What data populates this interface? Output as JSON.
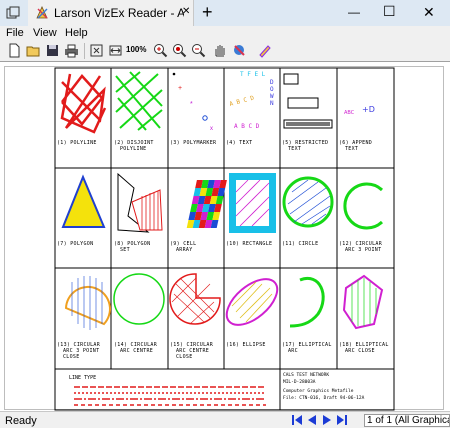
{
  "window": {
    "tab_title": "Larson VizEx Reader - A",
    "new_tab": "+",
    "minimize": "—",
    "maximize": "☐",
    "close": "✕"
  },
  "menu": {
    "items": [
      "File",
      "View",
      "Help"
    ]
  },
  "toolbar": {
    "zoom_label": "100%",
    "icons": [
      "new-file-icon",
      "open-folder-icon",
      "save-icon",
      "print-icon",
      "fit-page-icon",
      "fit-width-icon",
      "zoom-100-icon",
      "zoom-in-icon",
      "zoom-window-icon",
      "zoom-out-icon",
      "pan-hand-icon",
      "layers-icon",
      "markup-icon"
    ]
  },
  "drawing": {
    "cells": [
      {
        "n": 1,
        "caption": [
          "(1) POLYLINE"
        ]
      },
      {
        "n": 2,
        "caption": [
          "(2) DISJOINT",
          "POLYLINE"
        ]
      },
      {
        "n": 3,
        "caption": [
          "(3) POLYMARKER"
        ]
      },
      {
        "n": 4,
        "caption": [
          "(4) TEXT"
        ]
      },
      {
        "n": 5,
        "caption": [
          "(5) RESTRICTED",
          "TEXT"
        ]
      },
      {
        "n": 6,
        "caption": [
          "(6) APPEND",
          "TEXT"
        ]
      },
      {
        "n": 7,
        "caption": [
          "(7) POLYGON"
        ]
      },
      {
        "n": 8,
        "caption": [
          "(8) POLYGON",
          "SET"
        ]
      },
      {
        "n": 9,
        "caption": [
          "(9) CELL",
          "ARRAY"
        ]
      },
      {
        "n": 10,
        "caption": [
          "(10) RECTANGLE"
        ]
      },
      {
        "n": 11,
        "caption": [
          "(11) CIRCLE"
        ]
      },
      {
        "n": 12,
        "caption": [
          "(12) CIRCULAR",
          "ARC 3 POINT"
        ]
      },
      {
        "n": 13,
        "caption": [
          "(13) CIRCULAR",
          "ARC 3 POINT",
          "CLOSE"
        ]
      },
      {
        "n": 14,
        "caption": [
          "(14) CIRCULAR",
          "ARC CENTRE"
        ]
      },
      {
        "n": 15,
        "caption": [
          "(15) CIRCULAR",
          "ARC CENTRE",
          "CLOSE"
        ]
      },
      {
        "n": 16,
        "caption": [
          "(16) ELLIPSE"
        ]
      },
      {
        "n": 17,
        "caption": [
          "(17) ELLIPTICAL",
          "ARC"
        ]
      },
      {
        "n": 18,
        "caption": [
          "(18) ELLIPTICAL",
          "ARC CLOSE"
        ]
      }
    ],
    "text_samples": {
      "tfel": "T F E L",
      "down": "D O W N",
      "abcd": "A B C D",
      "abcd2": "A B C D",
      "append_a": "ABC",
      "append_b": "+D"
    },
    "line_type": "LINE TYPE",
    "title_block": [
      "CALS TEST NETWORK",
      "MIL-D-28003A",
      "Computer Graphics Metafile",
      "File: CTN-016, Draft 94-06-12A"
    ]
  },
  "status": {
    "text": "Ready",
    "page": "1 of 1 (All Graphical F"
  }
}
